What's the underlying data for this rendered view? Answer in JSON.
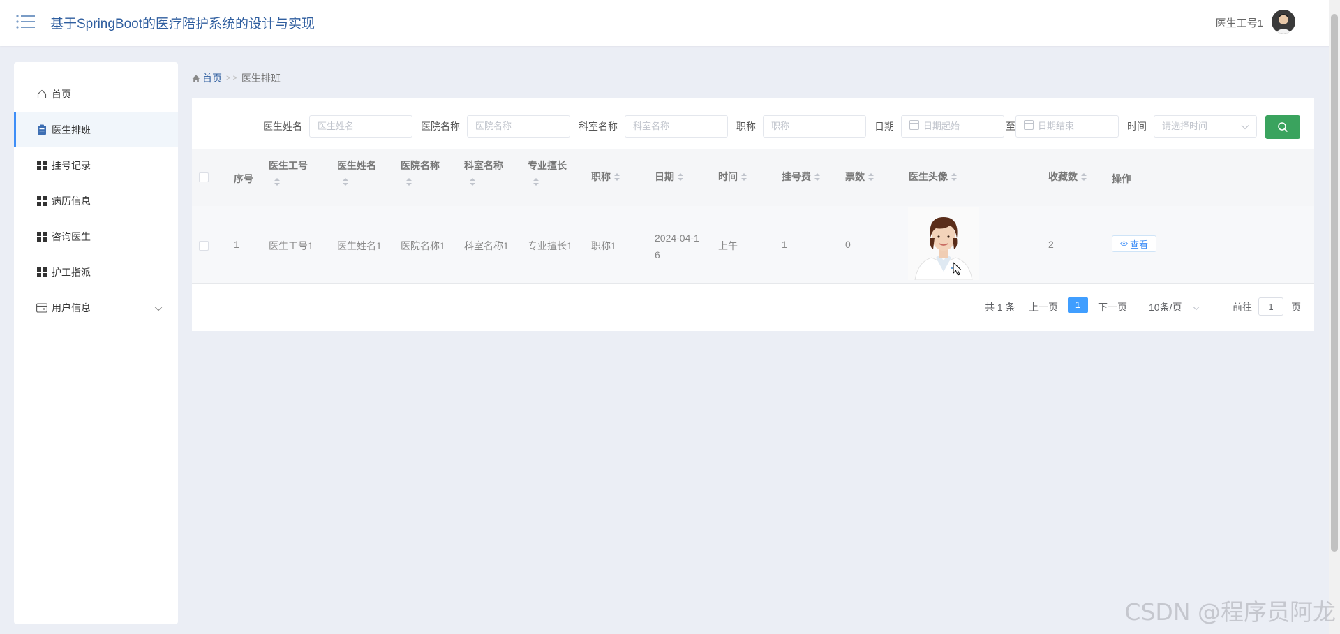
{
  "header": {
    "title": "基于SpringBoot的医疗陪护系统的设计与实现",
    "user_name": "医生工号1"
  },
  "sidebar": {
    "items": [
      {
        "label": "首页",
        "icon": "home-icon"
      },
      {
        "label": "医生排班",
        "icon": "clipboard-icon",
        "active": true
      },
      {
        "label": "挂号记录",
        "icon": "grid-icon"
      },
      {
        "label": "病历信息",
        "icon": "grid-icon"
      },
      {
        "label": "咨询医生",
        "icon": "grid-icon"
      },
      {
        "label": "护工指派",
        "icon": "grid-icon"
      },
      {
        "label": "用户信息",
        "icon": "wallet-icon",
        "has_children": true
      }
    ]
  },
  "breadcrumb": {
    "home": "首页",
    "separator": "> >",
    "current": "医生排班"
  },
  "search": {
    "doctor_name_label": "医生姓名",
    "doctor_name_placeholder": "医生姓名",
    "hospital_label": "医院名称",
    "hospital_placeholder": "医院名称",
    "department_label": "科室名称",
    "department_placeholder": "科室名称",
    "title_label": "职称",
    "title_placeholder": "职称",
    "date_label": "日期",
    "date_start_placeholder": "日期起始",
    "date_to": "至",
    "date_end_placeholder": "日期结束",
    "time_label": "时间",
    "time_placeholder": "请选择时间"
  },
  "table": {
    "headers": {
      "index": "序号",
      "doctor_no": "医生工号",
      "doctor_name": "医生姓名",
      "hospital": "医院名称",
      "department": "科室名称",
      "specialty": "专业擅长",
      "title": "职称",
      "date": "日期",
      "time": "时间",
      "fee": "挂号费",
      "tickets": "票数",
      "avatar": "医生头像",
      "favorites": "收藏数",
      "actions": "操作"
    },
    "rows": [
      {
        "index": "1",
        "doctor_no": "医生工号1",
        "doctor_name": "医生姓名1",
        "hospital": "医院名称1",
        "department": "科室名称1",
        "specialty": "专业擅长1",
        "title": "职称1",
        "date_line1": "2024-04-1",
        "date_line2": "6",
        "time": "上午",
        "fee": "1",
        "tickets": "0",
        "favorites": "2",
        "view_label": "查看"
      }
    ]
  },
  "pagination": {
    "total": "共 1 条",
    "prev": "上一页",
    "current_page": "1",
    "next": "下一页",
    "page_size": "10条/页",
    "goto_label": "前往",
    "goto_value": "1",
    "page_suffix": "页"
  },
  "watermark": "CSDN @程序员阿龙",
  "colors": {
    "accent": "#409eff",
    "search_button": "#3aa35e",
    "title": "#2f5e9f",
    "background": "#ebeef5"
  }
}
